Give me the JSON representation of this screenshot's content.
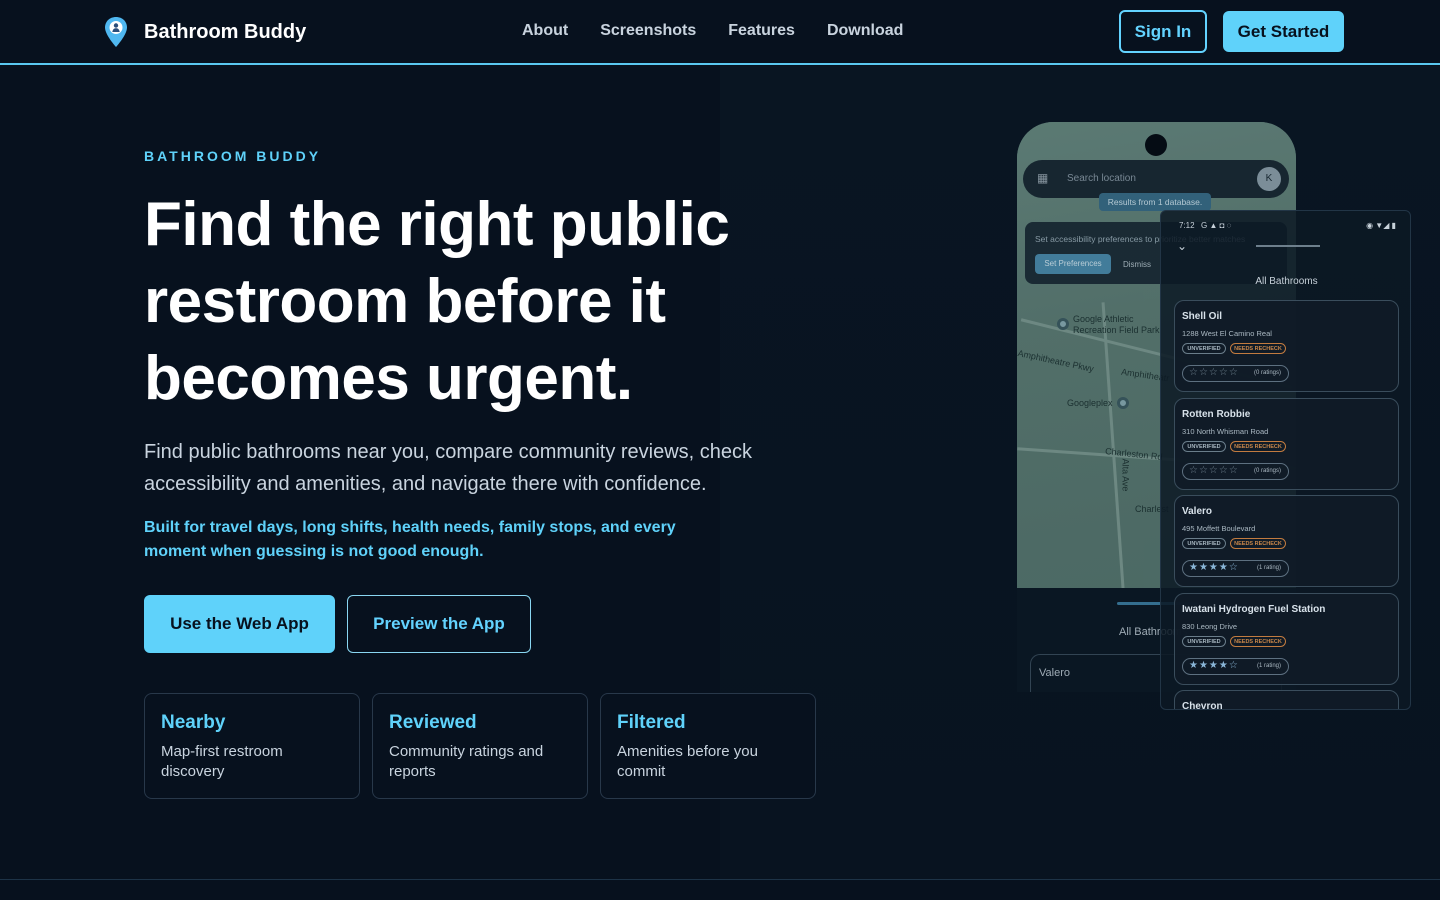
{
  "nav": {
    "brand": "Bathroom Buddy",
    "links": [
      "About",
      "Screenshots",
      "Features",
      "Download"
    ],
    "sign_in": "Sign In",
    "get_started": "Get Started"
  },
  "hero": {
    "eyebrow": "BATHROOM BUDDY",
    "headline": "Find the right public restroom before it becomes urgent.",
    "subtext": "Find public bathrooms near you, compare community reviews, check accessibility and amenities, and navigate there with confidence.",
    "highlight": "Built for travel days, long shifts, health needs, family stops, and every moment when guessing is not good enough.",
    "primary_cta": "Use the Web App",
    "secondary_cta": "Preview the App"
  },
  "features": [
    {
      "title": "Nearby",
      "desc": "Map-first restroom discovery"
    },
    {
      "title": "Reviewed",
      "desc": "Community ratings and reports"
    },
    {
      "title": "Filtered",
      "desc": "Amenities before you commit"
    }
  ],
  "phone_map": {
    "search_placeholder": "Search location",
    "avatar_initial": "K",
    "results_chip": "Results from 1 database.",
    "prefs_text": "Set accessibility preferences to prioritize better matches",
    "prefs_button": "Set Preferences",
    "dismiss": "Dismiss",
    "map_labels": {
      "google_athletic": "Google Athletic",
      "recreation_field": "Recreation Field Park",
      "amphitheatre_pkwy": "Amphitheatre Pkwy",
      "amphitheatre": "Amphitheatr",
      "googleplex": "Googleplex",
      "charleston_rd": "Charleston Rd",
      "alta_ave": "Alta Ave",
      "charleston": "Charlest"
    },
    "sheet_title": "All Bathrooms",
    "first_row": "Valero"
  },
  "phone_list": {
    "time": "7:12",
    "title": "All Bathrooms",
    "tag_unverified": "UNVERIFIED",
    "tag_recheck": "NEEDS RECHECK",
    "items": [
      {
        "name": "Shell Oil",
        "address": "1288 West El Camino Real",
        "ratings": "(0 ratings)",
        "stars": 0
      },
      {
        "name": "Rotten Robbie",
        "address": "310 North Whisman Road",
        "ratings": "(0 ratings)",
        "stars": 0
      },
      {
        "name": "Valero",
        "address": "495 Moffett Boulevard",
        "ratings": "(1 rating)",
        "stars": 4
      },
      {
        "name": "Iwatani Hydrogen Fuel Station",
        "address": "830 Leong Drive",
        "ratings": "(1 rating)",
        "stars": 4
      },
      {
        "name": "Chevron",
        "address": "",
        "ratings": "",
        "stars": 0
      }
    ]
  },
  "colors": {
    "background": "#07111e",
    "accent": "#5fd2fa",
    "text_muted": "#c9d4df",
    "recheck_orange": "#c9874a"
  }
}
